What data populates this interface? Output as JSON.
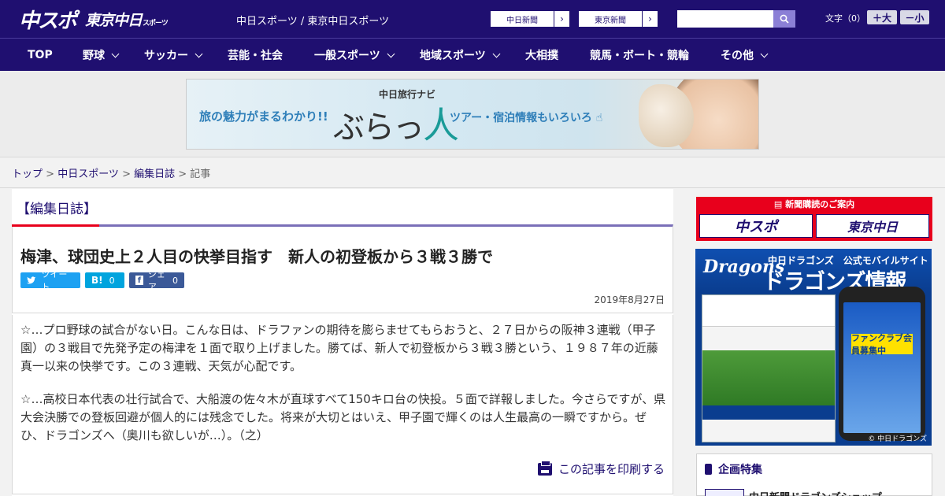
{
  "header": {
    "logo_main": "中スポ",
    "logo_tokyo": "東京中日",
    "logo_tokyo_small": "スポーツ",
    "site_links": "中日スポーツ / 東京中日スポーツ",
    "btn_chunichi": "中日新聞",
    "btn_tokyo": "東京新聞",
    "search_placeholder": "",
    "font_size_label": "文字（0）",
    "font_bigger": "＋大",
    "font_smaller": "－小"
  },
  "nav": {
    "items": [
      {
        "label": "TOP"
      },
      {
        "label": "野球"
      },
      {
        "label": "サッカー"
      },
      {
        "label": "芸能・社会"
      },
      {
        "label": "一般スポーツ"
      },
      {
        "label": "地域スポーツ"
      },
      {
        "label": "大相撲"
      },
      {
        "label": "競馬・ボート・競輪"
      },
      {
        "label": "その他"
      }
    ]
  },
  "banner": {
    "left_copy": "旅の魅力がまるわかり!!",
    "sub": "中日旅行ナビ",
    "logo_a": "ぶらっ",
    "logo_b": "人",
    "right_copy": "ツアー・宿泊情報もいろいろ"
  },
  "breadcrumb": {
    "home": "トップ",
    "sep": " > ",
    "site": "中日スポーツ",
    "category": "編集日誌",
    "current": "記事"
  },
  "article": {
    "section": "【編集日誌】",
    "headline": "梅津、球団史上２人目の快挙目指す　新人の初登板から３戦３勝で",
    "share_tweet": "ツイート",
    "share_hatena_label": "B!",
    "share_hatena_count": "0",
    "share_fb": "シェア",
    "share_fb_count": "0",
    "date": "2019年8月27日",
    "para1": "☆…プロ野球の試合がない日。こんな日は、ドラファンの期待を膨らませてもらおうと、２７日からの阪神３連戦（甲子園）の３戦目で先発予定の梅津を１面で取り上げました。勝てば、新人で初登板から３戦３勝という、１９８７年の近藤真一以来の快挙です。この３連戦、天気が心配です。",
    "para2": "☆…高校日本代表の壮行試合で、大船渡の佐々木が直球すべて150キロ台の快投。５面で詳報しました。今さらですが、県大会決勝での登板回避が個人的には残念でした。将来が大切とはいえ、甲子園で輝くのは人生最高の一瞬ですから。ぜひ、ドラゴンズへ（奥川も欲しいが…）。（之）",
    "print": "この記事を印刷する"
  },
  "sidebar": {
    "subscribe_header": "新聞購読のご案内",
    "subscribe_a": "中スポ",
    "subscribe_b": "東京中日",
    "dragons_logo": "Dragons",
    "dragons_sub": "中日ドラゴンズ　公式モバイルサイト",
    "dragons_title": "ドラゴンズ情報",
    "dragons_badge": "ファンクラブ会員募集中",
    "dragons_copy": "© 中日ドラゴンズ",
    "special_title": "企画特集",
    "special_item": "中日新聞ドラゴンズショップ"
  },
  "colors": {
    "brand_navy": "#1f0f70",
    "accent_red": "#e8001c",
    "twitter": "#1da1f2",
    "hatena": "#00a4de",
    "facebook": "#3b5998"
  }
}
